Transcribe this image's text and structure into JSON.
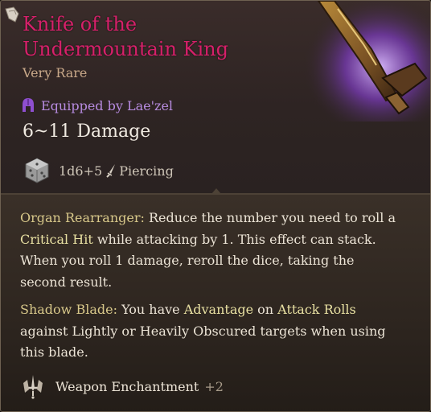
{
  "item": {
    "name": "Knife of the Undermountain King",
    "rarity": "Very Rare",
    "equipped": "Equipped by Lae'zel",
    "damage": "6~11 Damage",
    "dice": "1d6+5",
    "damage_type": "Piercing"
  },
  "icons": {
    "corner": "corner-tab-icon",
    "equipped": "helmet-icon",
    "dice": "d6-die-icon",
    "damage_type": "dagger-icon",
    "enchant": "sword-shield-icon",
    "art": "dagger-artwork"
  },
  "passives": [
    {
      "name": "Organ Rearranger:",
      "text_1": " Reduce the number you need to roll a ",
      "kw_1": "Critical Hit",
      "text_2": " while attacking by 1. This effect can stack. When you roll 1 damage, reroll the dice, taking the second result."
    },
    {
      "name": "Shadow Blade:",
      "text_1": " You have ",
      "kw_1": "Advantage",
      "text_2": " on ",
      "kw_2": "Attack Rolls",
      "text_3": " against Lightly or Heavily Obscured targets when using this blade."
    }
  ],
  "enchantment": {
    "label": "Weapon Enchantment",
    "bonus": "+2"
  },
  "colors": {
    "name": "#d6206a",
    "rarity": "#c9a98a",
    "equipped": "#b78be0",
    "keyword": "#e8e0a2"
  }
}
